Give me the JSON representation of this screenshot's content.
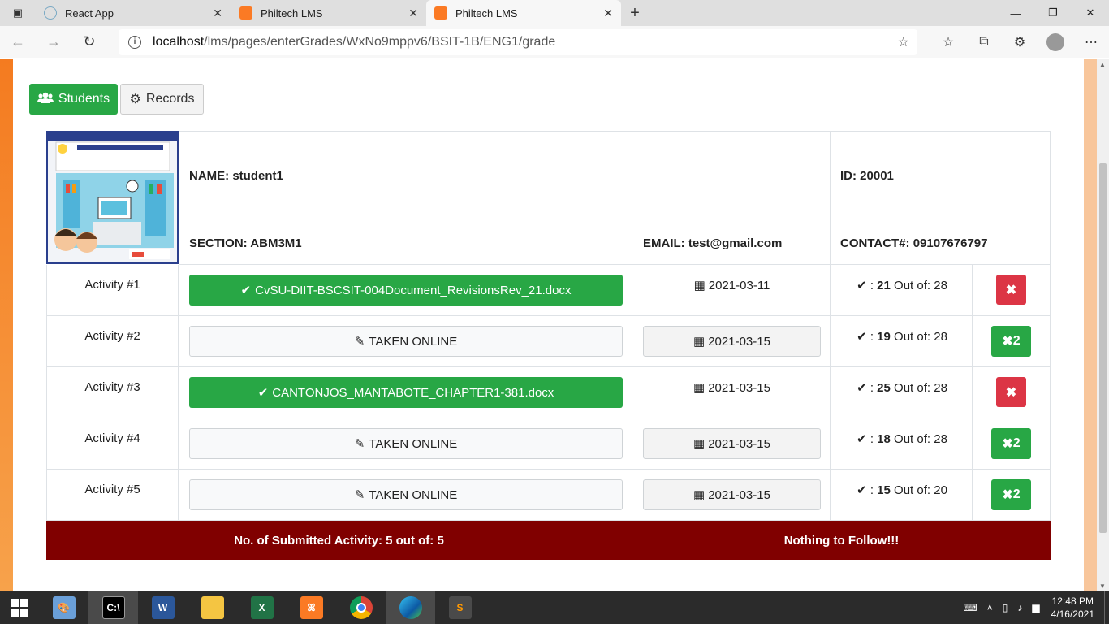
{
  "browser": {
    "tabs": [
      {
        "title": "React App",
        "icon": "react-icon"
      },
      {
        "title": "Philtech LMS",
        "icon": "xampp-icon"
      },
      {
        "title": "Philtech LMS",
        "icon": "xampp-icon",
        "active": true
      }
    ],
    "url_host": "localhost",
    "url_path": "/lms/pages/enterGrades/WxNo9mppv6/BSIT-1B/ENG1/grade"
  },
  "page": {
    "buttons": {
      "students": "Students",
      "records": "Records"
    },
    "profile": {
      "name": "NAME: student1",
      "id": "ID: 20001",
      "section": "SECTION: ABM3M1",
      "email": "EMAIL: test@gmail.com",
      "contact": "CONTACT#: 09107676797"
    },
    "activities": [
      {
        "label": "Activity #1",
        "file": "CvSU-DIIT-BSCSIT-004Document_RevisionsRev_21.docx",
        "type": "file",
        "date": "2021-03-11",
        "score": "21",
        "out_of": "Out of: 28",
        "action": "delete"
      },
      {
        "label": "Activity #2",
        "file": "TAKEN ONLINE",
        "type": "online",
        "date": "2021-03-15",
        "score": "19",
        "out_of": "Out of: 28",
        "action": "x2"
      },
      {
        "label": "Activity #3",
        "file": "CANTONJOS_MANTABOTE_CHAPTER1-381.docx",
        "type": "file",
        "date": "2021-03-15",
        "score": "25",
        "out_of": "Out of: 28",
        "action": "delete"
      },
      {
        "label": "Activity #4",
        "file": "TAKEN ONLINE",
        "type": "online",
        "date": "2021-03-15",
        "score": "18",
        "out_of": "Out of: 28",
        "action": "x2"
      },
      {
        "label": "Activity #5",
        "file": "TAKEN ONLINE",
        "type": "online",
        "date": "2021-03-15",
        "score": "15",
        "out_of": "Out of: 20",
        "action": "x2"
      }
    ],
    "x2_label": "2",
    "score_prefix": ": ",
    "footer": {
      "submitted": "No. of Submitted Activity: 5 out of: 5",
      "follow": "Nothing to Follow!!!"
    }
  },
  "taskbar": {
    "time": "12:48 PM",
    "date": "4/16/2021"
  },
  "colors": {
    "green": "#28a745",
    "red": "#dc3545",
    "maroon": "#800000",
    "orange": "#f47b20"
  }
}
